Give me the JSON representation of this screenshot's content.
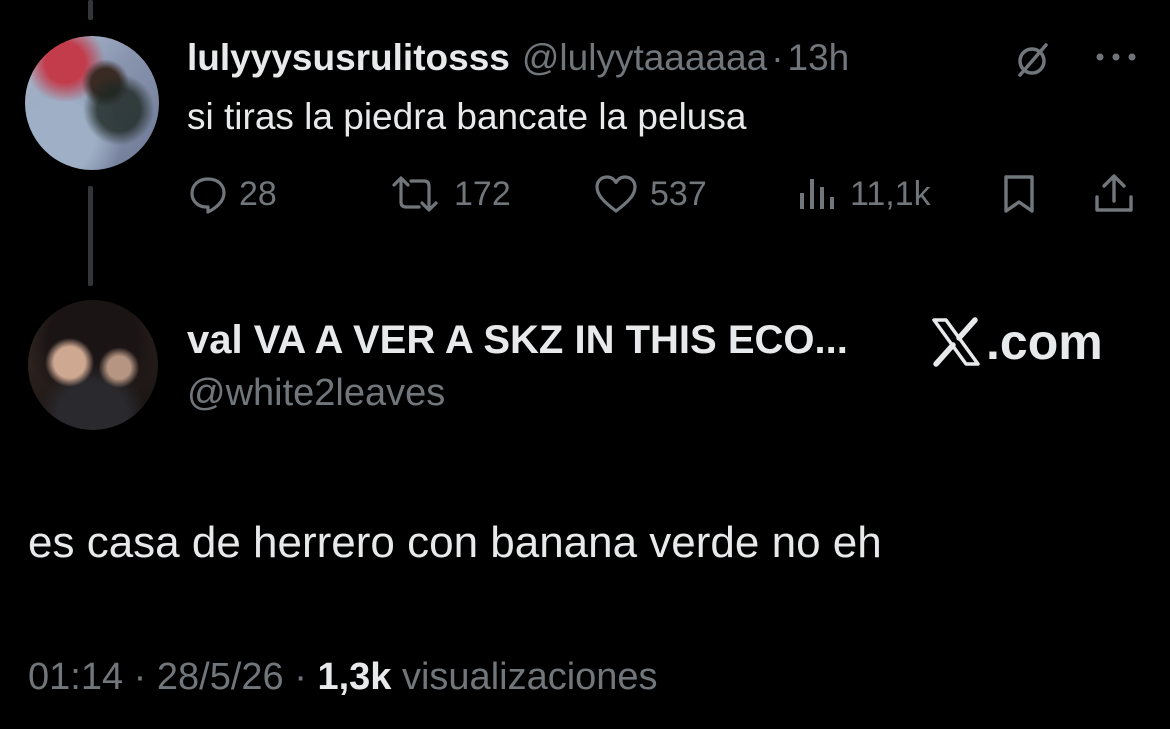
{
  "tweet1": {
    "display_name": "lulyyysusrulitosss",
    "handle": "@lulyytaaaaaa",
    "separator": "·",
    "time": "13h",
    "text": "si tiras la piedra bancate la pelusa",
    "stats": {
      "replies": "28",
      "retweets": "172",
      "likes": "537",
      "views": "11,1k"
    },
    "icons": {
      "grok": "grok-icon",
      "more": "more-icon",
      "reply": "reply-icon",
      "retweet": "retweet-icon",
      "like": "heart-icon",
      "views": "views-icon",
      "bookmark": "bookmark-icon",
      "share": "share-icon"
    }
  },
  "tweet2": {
    "display_name": "val VA A VER A SKZ IN THIS ECO...",
    "handle": "@white2leaves",
    "text": "es casa de herrero con banana verde no eh",
    "footer": {
      "time": "01:14",
      "separator": "·",
      "date": "28/5/26",
      "views_count": "1,3k",
      "views_label": "visualizaciones"
    }
  },
  "brand": {
    "domain": ".com",
    "logo_icon": "x-logo-icon"
  },
  "colors": {
    "background": "#000000",
    "primary_text": "#e7e9ea",
    "secondary_text": "#71767b",
    "thread_line": "#333639"
  }
}
